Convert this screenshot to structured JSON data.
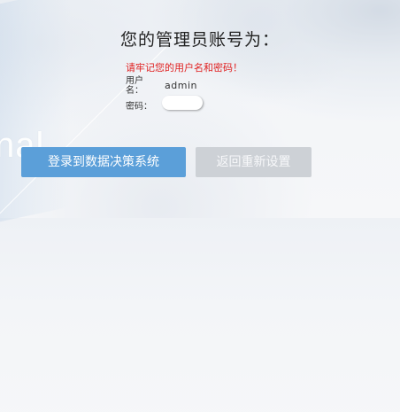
{
  "background_word": "nal",
  "title": "您的管理员账号为：",
  "warning": "请牢记您的用户名和密码！",
  "username": {
    "label": "用户名：",
    "value": "admin"
  },
  "password": {
    "label": "密码：",
    "value": ""
  },
  "buttons": {
    "login": "登录到数据决策系统",
    "reset": "返回重新设置"
  },
  "colors": {
    "primary_button": "#5b9fd9",
    "secondary_button": "#cdd1d6",
    "warning_text": "#e02020"
  }
}
